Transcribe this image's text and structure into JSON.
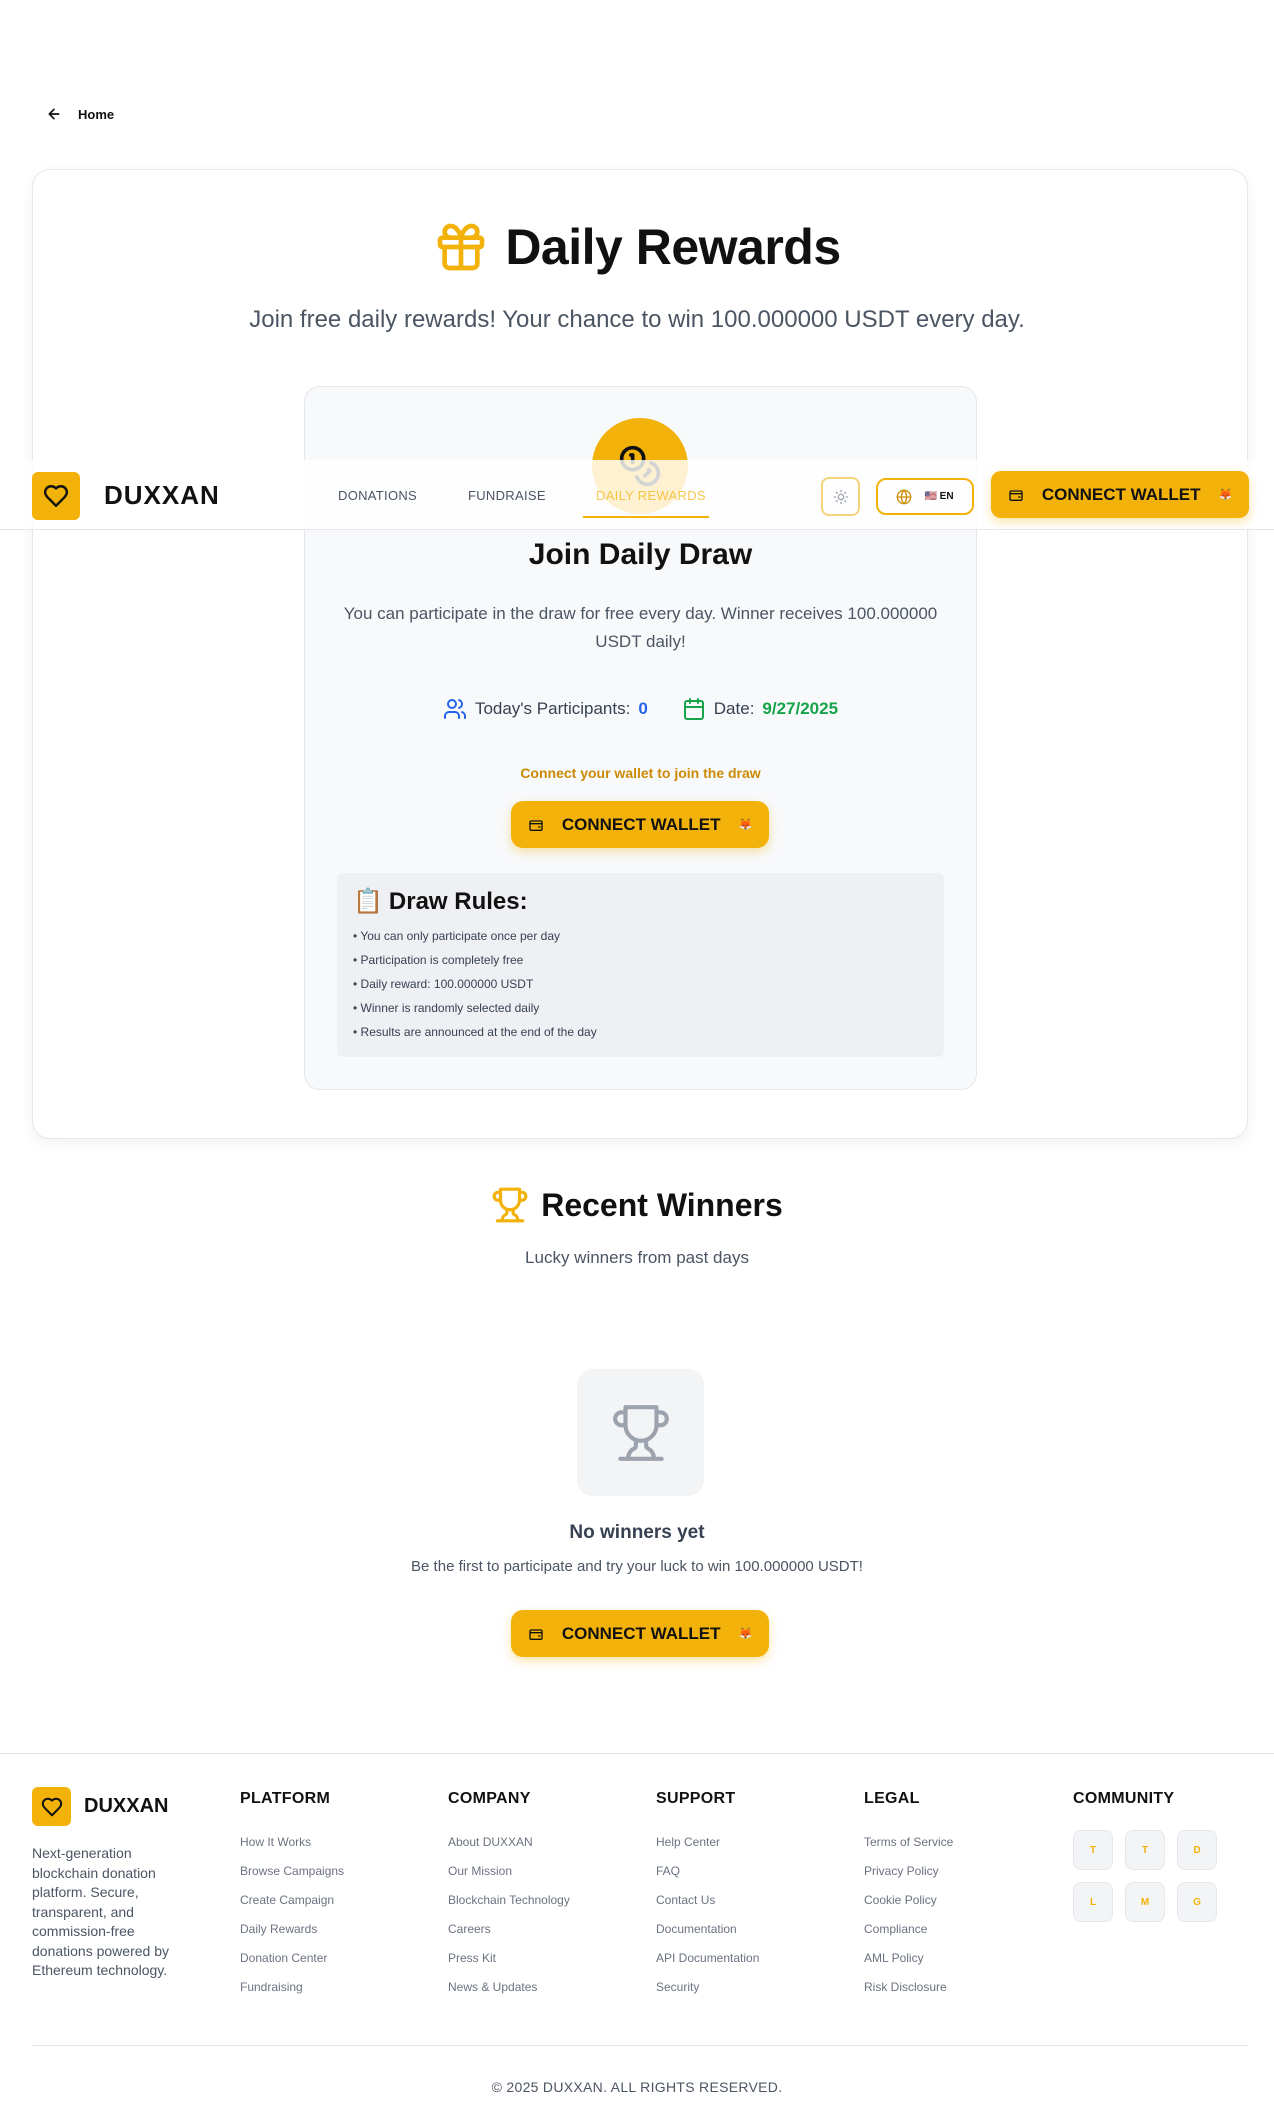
{
  "back": {
    "label": "Home"
  },
  "hero": {
    "title": "Daily Rewards",
    "subtitle": "Join free daily rewards! Your chance to win 100.000000 USDT every day."
  },
  "draw": {
    "title": "Join Daily Draw",
    "description": "You can participate in the draw for free every day. Winner receives 100.000000 USDT daily!",
    "participants_label": "Today's Participants:",
    "participants_value": "0",
    "date_label": "Date:",
    "date_value": "9/27/2025",
    "connect_note": "Connect your wallet to join the draw",
    "connect_label": "CONNECT WALLET"
  },
  "rules": {
    "emoji": "📋",
    "title": "Draw Rules:",
    "items": [
      "You can only participate once per day",
      "Participation is completely free",
      "Daily reward: 100.000000 USDT",
      "Winner is randomly selected daily",
      "Results are announced at the end of the day"
    ]
  },
  "header": {
    "brand": "DUXXAN",
    "nav": [
      "DONATIONS",
      "FUNDRAISE",
      "DAILY REWARDS"
    ],
    "lang": "🇺🇸 EN",
    "connect_label": "CONNECT WALLET"
  },
  "winners": {
    "title": "Recent Winners",
    "subtitle": "Lucky winners from past days",
    "empty_title": "No winners yet",
    "empty_sub": "Be the first to participate and try your luck to win 100.000000 USDT!",
    "connect_label": "CONNECT WALLET"
  },
  "footer": {
    "brand": "DUXXAN",
    "description": "Next-generation blockchain donation platform. Secure, transparent, and commission-free donations powered by Ethereum technology.",
    "columns": [
      {
        "title": "PLATFORM",
        "links": [
          "How It Works",
          "Browse Campaigns",
          "Create Campaign",
          "Daily Rewards",
          "Donation Center",
          "Fundraising"
        ]
      },
      {
        "title": "COMPANY",
        "links": [
          "About DUXXAN",
          "Our Mission",
          "Blockchain Technology",
          "Careers",
          "Press Kit",
          "News & Updates"
        ]
      },
      {
        "title": "SUPPORT",
        "links": [
          "Help Center",
          "FAQ",
          "Contact Us",
          "Documentation",
          "API Documentation",
          "Security"
        ]
      },
      {
        "title": "LEGAL",
        "links": [
          "Terms of Service",
          "Privacy Policy",
          "Cookie Policy",
          "Compliance",
          "AML Policy",
          "Risk Disclosure"
        ]
      }
    ],
    "community_title": "COMMUNITY",
    "community": [
      "T",
      "T",
      "D",
      "L",
      "M",
      "G"
    ],
    "copyright": "© 2025 DUXXAN. ALL RIGHTS RESERVED."
  },
  "colors": {
    "accent": "#f2b20a",
    "blue": "#2563eb",
    "green": "#16a34a",
    "note": "#ca8a04"
  }
}
